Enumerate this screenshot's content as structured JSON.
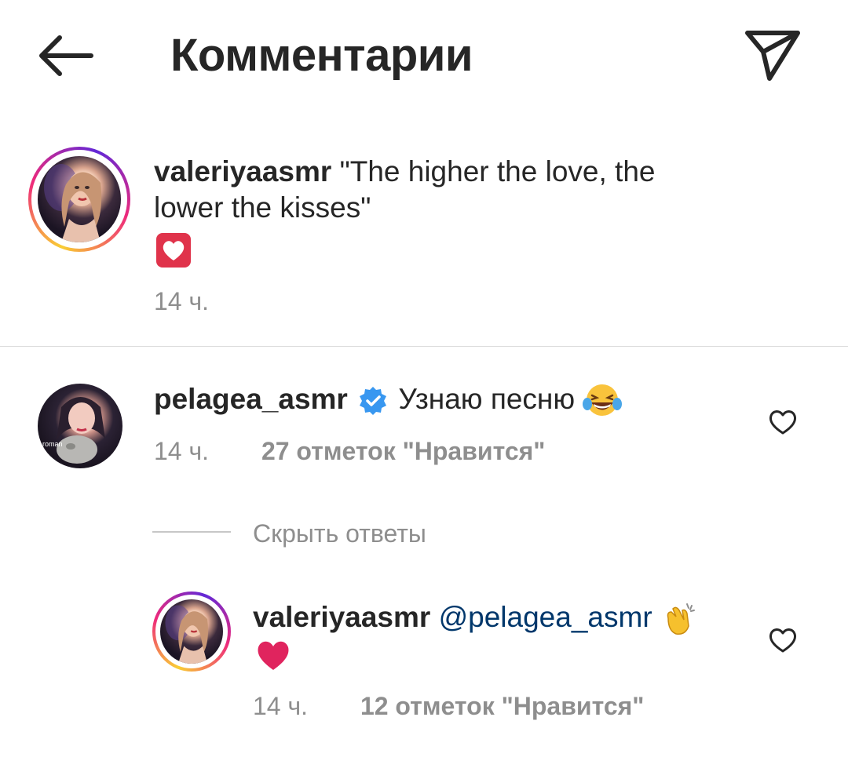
{
  "header": {
    "title": "Комментарии",
    "back_icon": "arrow-left-icon",
    "share_icon": "paper-plane-icon"
  },
  "caption": {
    "username": "valeriyaasmr",
    "text": "\"The higher the love, the lower the kisses\"",
    "emoji_icon": "white-heart-icon",
    "time": "14 ч."
  },
  "comments": [
    {
      "username": "pelagea_asmr",
      "verified": true,
      "text": "Узнаю песню",
      "emoji_icon": "laughing-tears-icon",
      "time": "14 ч.",
      "likes": "27 отметок \"Нравится\"",
      "avatar_caption": "roman",
      "replies_toggle": "Скрыть ответы",
      "replies": [
        {
          "username": "valeriyaasmr",
          "mention": "@pelagea_asmr",
          "emoji_icon": "clapping-hands-icon",
          "emoji2_icon": "red-heart-icon",
          "time": "14 ч.",
          "likes": "12 отметок \"Нравится\""
        }
      ]
    }
  ],
  "colors": {
    "text": "#262626",
    "secondary": "#8e8e8e",
    "mention": "#00376b",
    "verified": "#3897f0",
    "divider": "#dbdbdb",
    "heart": "#e0245e"
  }
}
